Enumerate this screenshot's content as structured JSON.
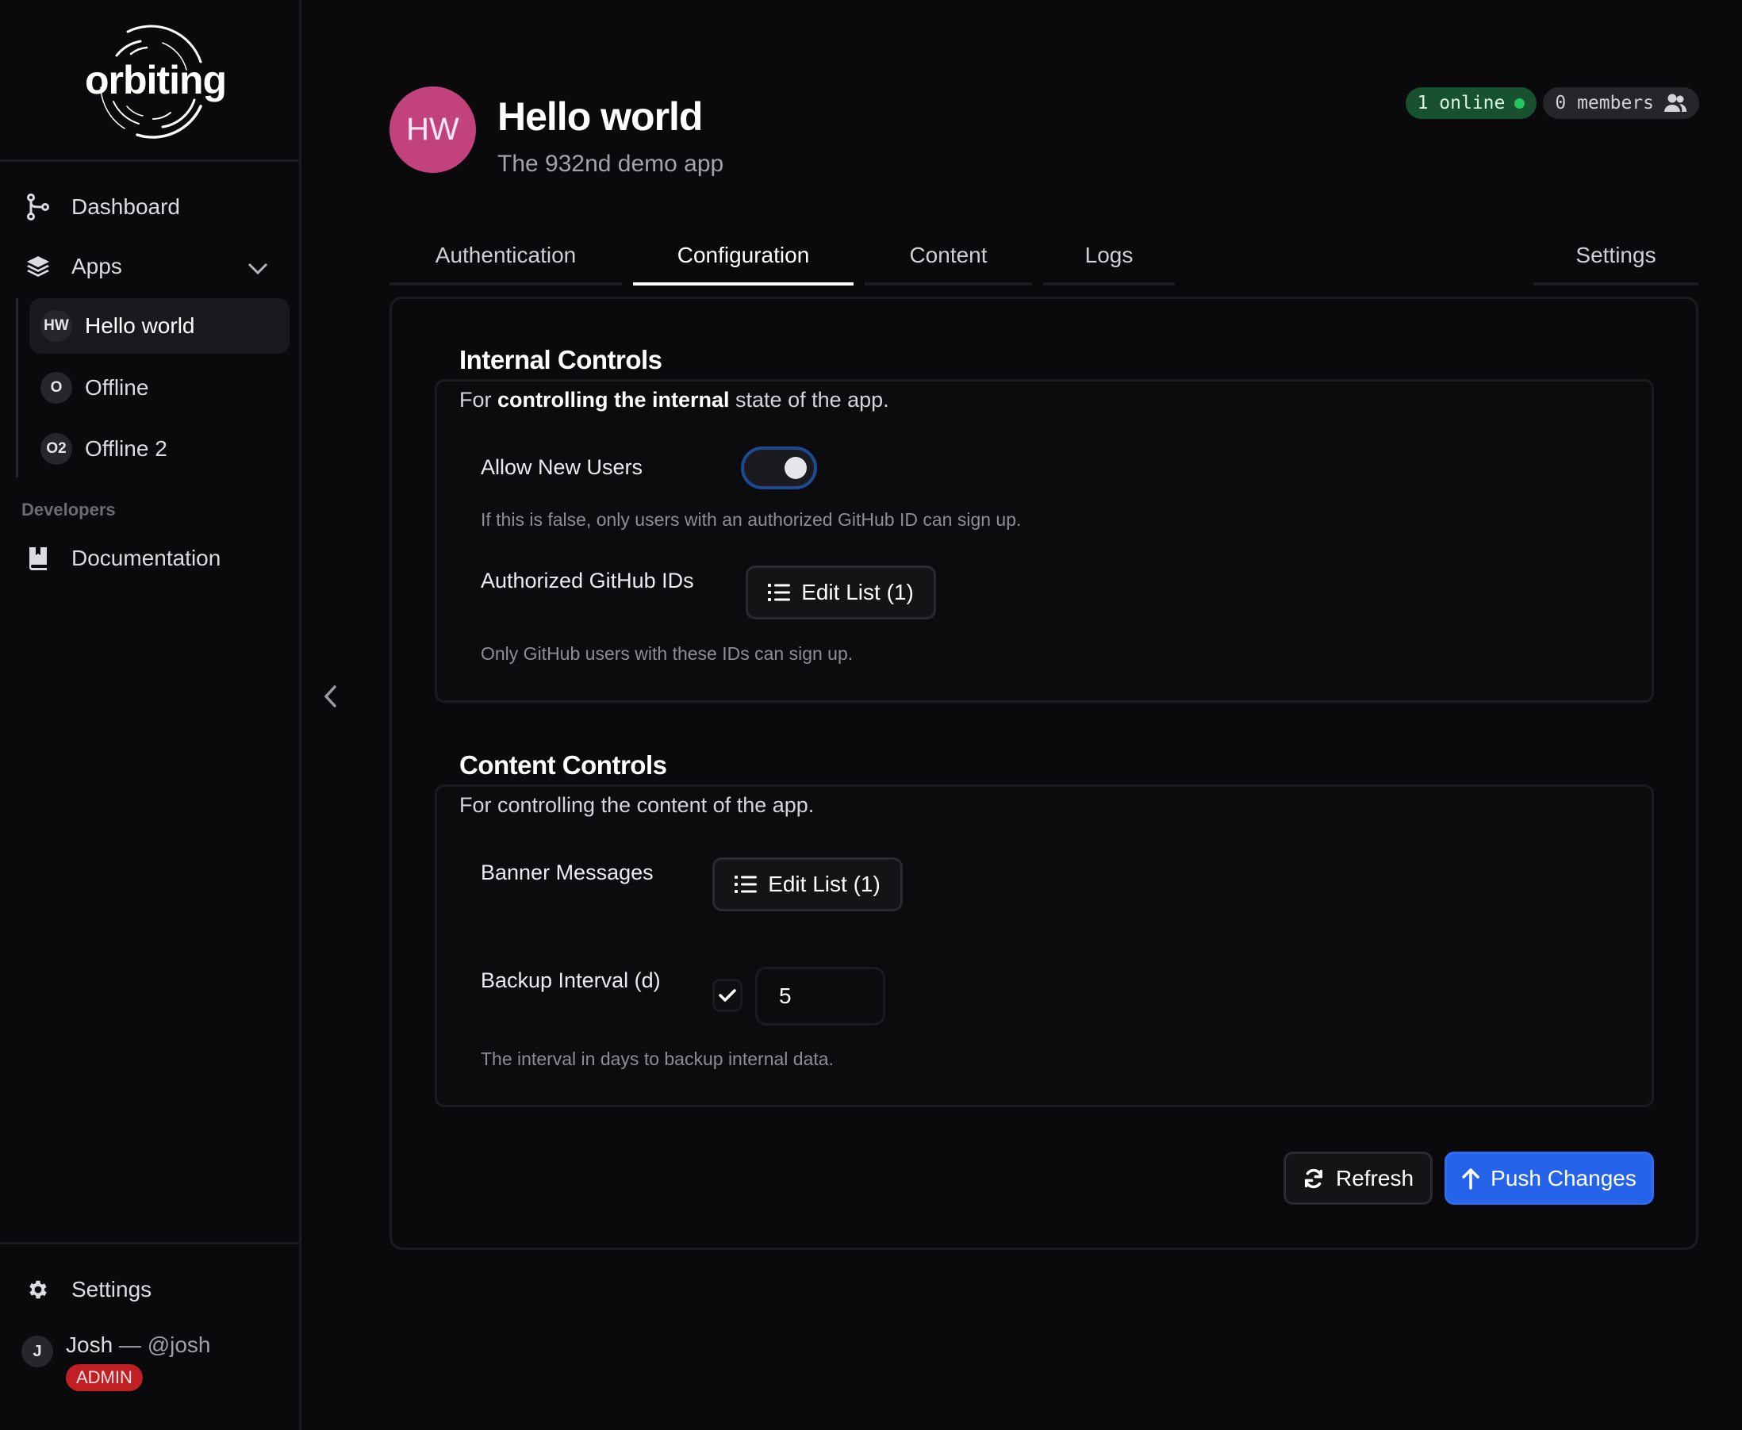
{
  "brand": {
    "logo_text": "orbiting"
  },
  "sidebar": {
    "nav": [
      {
        "label": "Dashboard",
        "icon": "git-branch-icon"
      },
      {
        "label": "Apps",
        "icon": "layers-icon"
      }
    ],
    "apps": [
      {
        "initials": "HW",
        "label": "Hello world",
        "active": true
      },
      {
        "initials": "O",
        "label": "Offline",
        "active": false
      },
      {
        "initials": "O2",
        "label": "Offline 2",
        "active": false
      }
    ],
    "developers_label": "Developers",
    "documentation_label": "Documentation",
    "settings_label": "Settings",
    "user": {
      "initial": "J",
      "name": "Josh",
      "separator": " — ",
      "handle": "@josh",
      "role": "ADMIN"
    }
  },
  "header": {
    "initials": "HW",
    "title": "Hello world",
    "subtitle": "The 932nd demo app",
    "online_badge": "1 online",
    "members_badge": "0 members"
  },
  "tabs": [
    {
      "label": "Authentication",
      "active": false
    },
    {
      "label": "Configuration",
      "active": true
    },
    {
      "label": "Content",
      "active": false
    },
    {
      "label": "Logs",
      "active": false
    },
    {
      "label": "Settings",
      "active": false
    }
  ],
  "internal_controls": {
    "title": "Internal Controls",
    "desc_prefix": "For ",
    "desc_bold": "controlling the internal",
    "desc_suffix": " state of the app.",
    "allow_new_users": {
      "label": "Allow New Users",
      "value": true,
      "help": "If this is false, only users with an authorized GitHub ID can sign up."
    },
    "authorized_ids": {
      "label": "Authorized GitHub IDs",
      "button": "Edit List (1)",
      "help": "Only GitHub users with these IDs can sign up."
    }
  },
  "content_controls": {
    "title": "Content Controls",
    "desc": "For controlling the content of the app.",
    "banner_messages": {
      "label": "Banner Messages",
      "button": "Edit List (1)"
    },
    "backup_interval": {
      "label": "Backup Interval (d)",
      "enabled": true,
      "value": "5",
      "help": "The interval in days to backup internal data."
    }
  },
  "actions": {
    "refresh": "Refresh",
    "push": "Push Changes"
  },
  "colors": {
    "accent": "#2563eb",
    "avatar": "#c2427e",
    "online": "#22c55e",
    "admin": "#c01f24"
  }
}
